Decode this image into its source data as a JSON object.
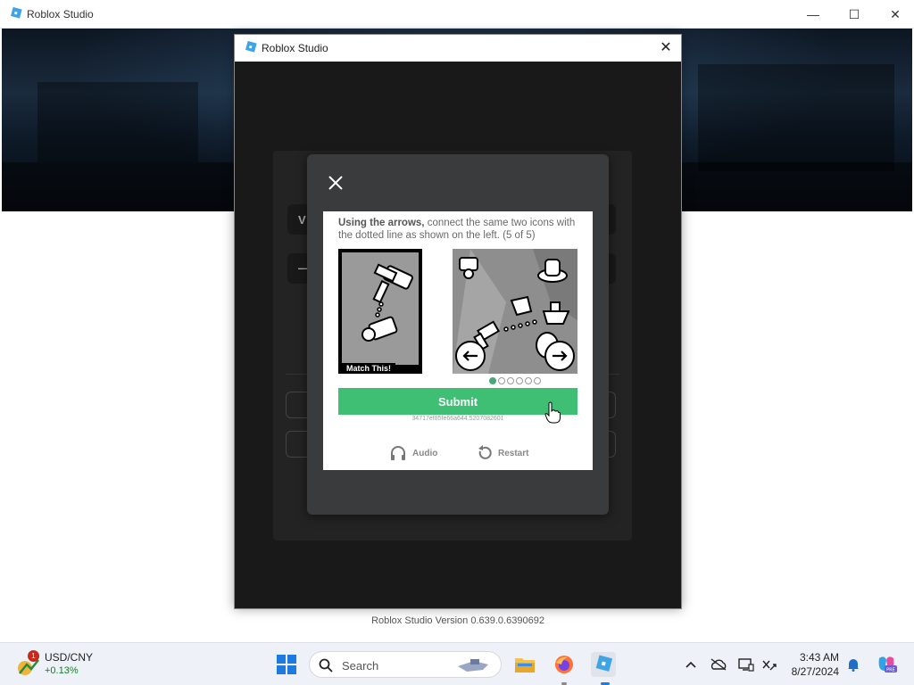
{
  "window": {
    "title": "Roblox Studio",
    "minimize_glyph": "—",
    "maximize_glyph": "☐",
    "close_glyph": "✕"
  },
  "dialog": {
    "title": "Roblox Studio",
    "close_glyph": "✕"
  },
  "login_panel": {
    "field1_fragment": "V",
    "field2_fragment": "—"
  },
  "captcha": {
    "instruction_bold": "Using the arrows,",
    "instruction_rest": " connect the same two icons with the dotted line as shown on the left. (5 of 5)",
    "match_label": "Match This!",
    "progress": {
      "current": 1,
      "total": 6
    },
    "submit_label": "Submit",
    "session_id": "34717ef85fe66a644.5207082601",
    "audio_label": "Audio",
    "restart_label": "Restart",
    "accent_color": "#3fbf73"
  },
  "version_text": "Roblox Studio Version 0.639.0.6390692",
  "taskbar": {
    "widget": {
      "pair": "USD/CNY",
      "change": "+0.13%",
      "badge": "1"
    },
    "search_placeholder": "Search",
    "apps": [
      "start-icon",
      "file-explorer-icon",
      "firefox-icon",
      "roblox-studio-icon"
    ],
    "tray_icons": [
      "chevron-up-icon",
      "onedrive-offline-icon",
      "display-icon",
      "network-off-icon"
    ],
    "time": "3:43 AM",
    "date": "8/27/2024"
  }
}
